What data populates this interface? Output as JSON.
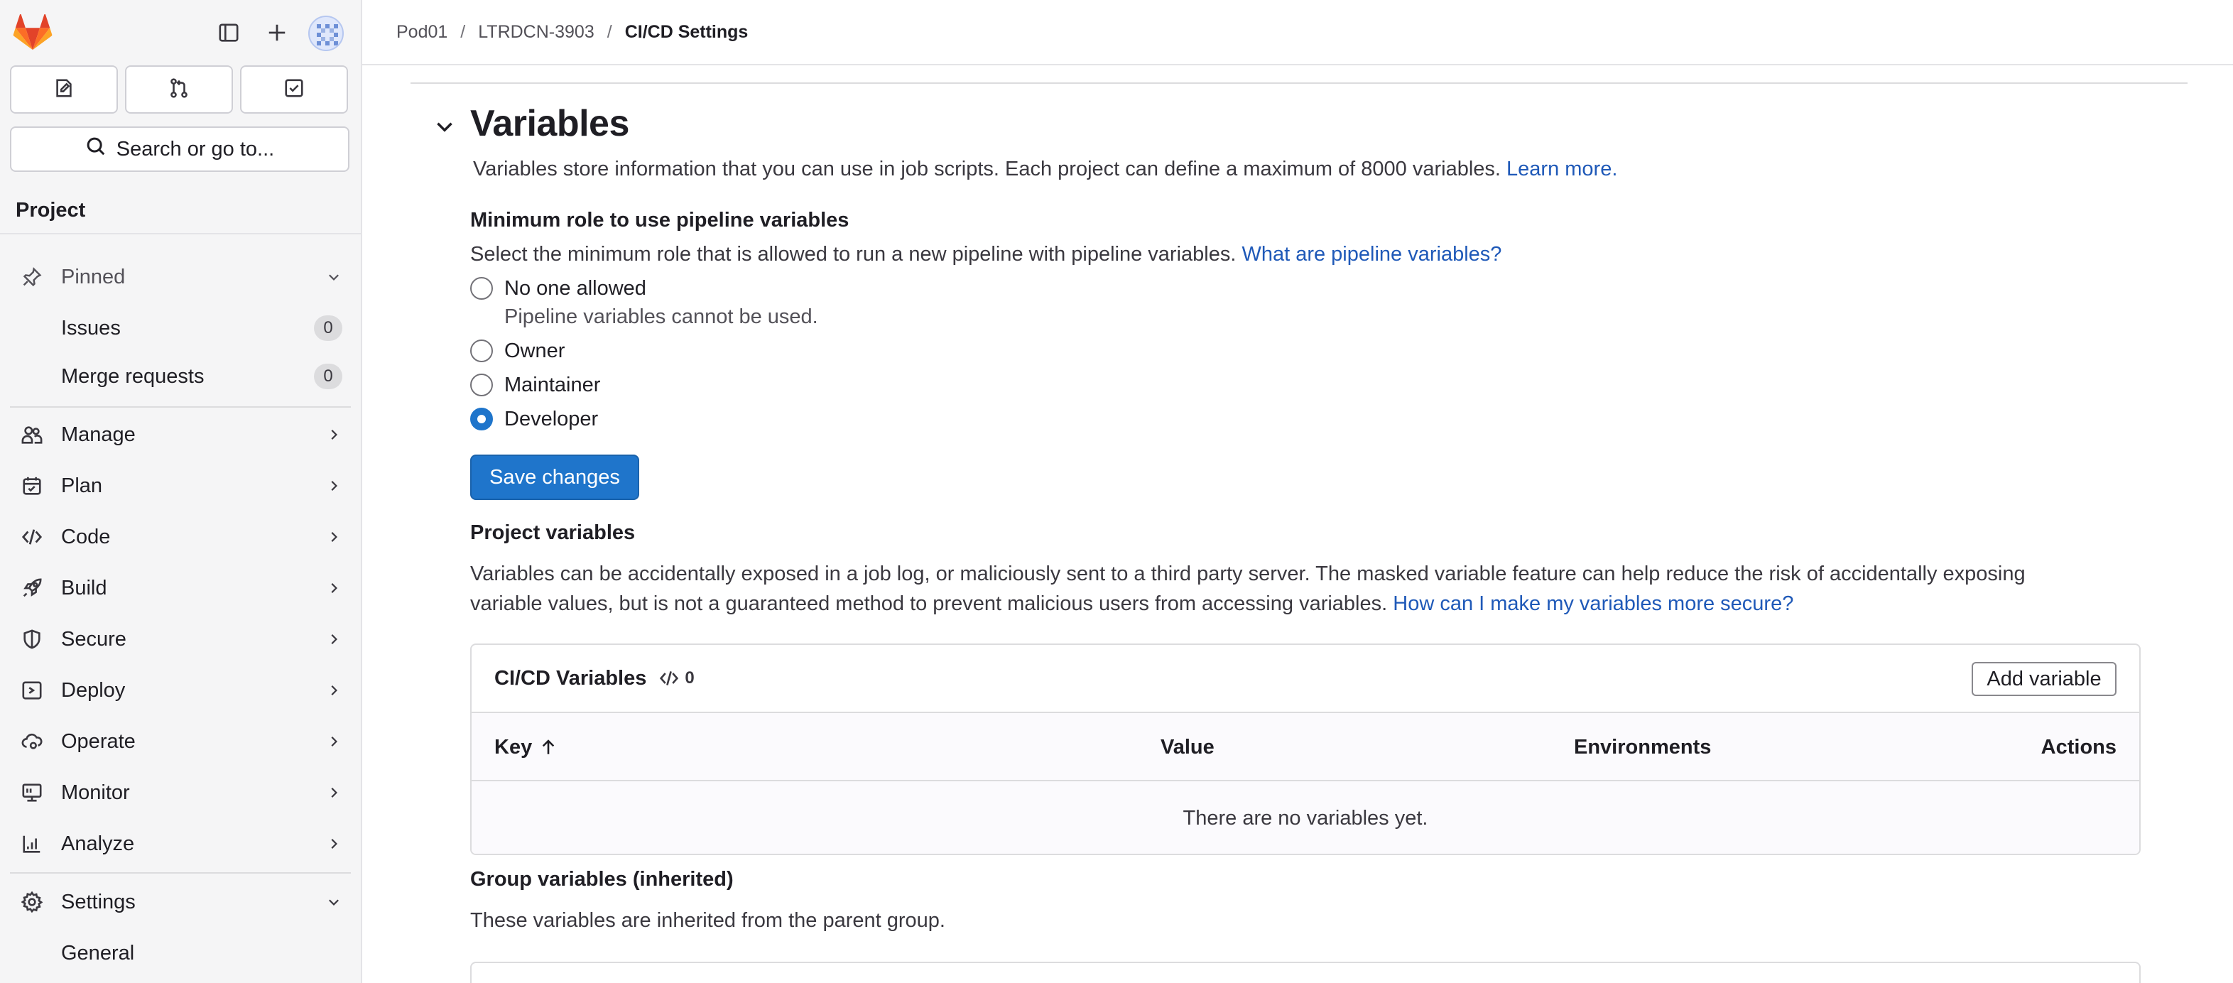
{
  "breadcrumb": {
    "items": [
      "Pod01",
      "LTRDCN-3903"
    ],
    "current": "CI/CD Settings",
    "separator": "/"
  },
  "sidebar": {
    "search_label": "Search or go to...",
    "section_title": "Project",
    "pinned": {
      "label": "Pinned"
    },
    "pinned_items": [
      {
        "label": "Issues",
        "count": "0"
      },
      {
        "label": "Merge requests",
        "count": "0"
      }
    ],
    "nav": [
      {
        "label": "Manage",
        "icon": "users-icon"
      },
      {
        "label": "Plan",
        "icon": "calendar-icon"
      },
      {
        "label": "Code",
        "icon": "code-icon"
      },
      {
        "label": "Build",
        "icon": "rocket-icon"
      },
      {
        "label": "Secure",
        "icon": "shield-icon"
      },
      {
        "label": "Deploy",
        "icon": "deploy-icon"
      },
      {
        "label": "Operate",
        "icon": "cloud-gear-icon"
      },
      {
        "label": "Monitor",
        "icon": "monitor-icon"
      },
      {
        "label": "Analyze",
        "icon": "chart-icon"
      }
    ],
    "settings": {
      "label": "Settings"
    },
    "settings_items": [
      {
        "label": "General"
      }
    ]
  },
  "variables": {
    "title": "Variables",
    "description": "Variables store information that you can use in job scripts. Each project can define a maximum of 8000 variables.",
    "learn_more": "Learn more.",
    "min_role": {
      "title": "Minimum role to use pipeline variables",
      "description": "Select the minimum role that is allowed to run a new pipeline with pipeline variables.",
      "help_link": "What are pipeline variables?",
      "options": [
        {
          "label": "No one allowed",
          "help": "Pipeline variables cannot be used.",
          "checked": false
        },
        {
          "label": "Owner",
          "checked": false
        },
        {
          "label": "Maintainer",
          "checked": false
        },
        {
          "label": "Developer",
          "checked": true
        }
      ],
      "save_label": "Save changes"
    },
    "project_variables": {
      "title": "Project variables",
      "description_line1": "Variables can be accidentally exposed in a job log, or maliciously sent to a third party server. The masked variable feature can help reduce the risk of accidentally exposing",
      "description_line2": "variable values, but is not a guaranteed method to prevent malicious users from accessing variables.",
      "secure_link": "How can I make my variables more secure?"
    },
    "cicd_card": {
      "title": "CI/CD Variables",
      "count": "0",
      "add_label": "Add variable",
      "columns": [
        "Key",
        "Value",
        "Environments",
        "Actions"
      ],
      "empty_text": "There are no variables yet."
    },
    "group_variables": {
      "title": "Group variables (inherited)",
      "description": "These variables are inherited from the parent group."
    }
  },
  "colors": {
    "primary": "#1f75cb",
    "link": "#1f59b8",
    "logo_orange": "#fc6d26",
    "logo_red": "#e24329",
    "logo_light": "#fca326"
  }
}
